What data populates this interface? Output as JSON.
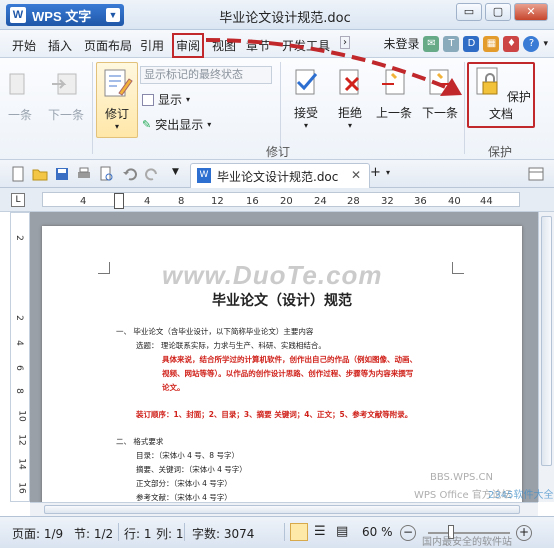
{
  "window": {
    "app_name": "WPS 文字",
    "doc_title": "毕业论文设计规范.doc",
    "controls": [
      "▭",
      "▢",
      "✕"
    ]
  },
  "menu": {
    "tabs": [
      "开始",
      "插入",
      "页面布局",
      "引用",
      "审阅",
      "视图",
      "章节",
      "开发工具"
    ],
    "login": "未登录"
  },
  "ribbon": {
    "prev_change": "一条",
    "next_change": "下一条",
    "revise": "修订",
    "markup_combo": "显示标记的最终状态",
    "show": "显示",
    "highlight": "突出显示",
    "accept": "接受",
    "reject": "拒绝",
    "prev": "上一条",
    "next": "下一条",
    "protect": "保护文档",
    "group_revise": "修订",
    "group_protect": "保护"
  },
  "doc_tab": {
    "title": "毕业论文设计规范.doc",
    "close": "✕",
    "add": "+"
  },
  "ruler": {
    "h_ticks": [
      "4",
      "4",
      "8",
      "12",
      "16",
      "20",
      "24",
      "28",
      "32",
      "36",
      "40",
      "44"
    ],
    "v_ticks": [
      "2",
      "2",
      "4",
      "6",
      "8",
      "10",
      "12",
      "14",
      "16"
    ]
  },
  "document": {
    "watermark": "www.DuoTe.com",
    "heading": "毕业论文（设计）规范",
    "lines": [
      {
        "text": "一、  毕业论文（含毕业设计，以下简称毕业论文）主要内容",
        "red": false
      },
      {
        "text": "选题：  理论联系实际，力求与生产、科研、实践相结合。",
        "red": false
      },
      {
        "text": "具体来说，结合所学过的计算机软件，创作出自己的作品（例如图像、动画、",
        "red": true
      },
      {
        "text": "视频、网站等等）。以作品的创作设计思路、创作过程、步骤等为内容来撰写",
        "red": true
      },
      {
        "text": "论文。",
        "red": true
      },
      {
        "text": "装订顺序：1、封面；2、目录；3、摘要  关键词；4、正文；5、参考文献等附录。",
        "red": true
      },
      {
        "text": "二、  格式要求",
        "red": false
      },
      {
        "text": "目录：（宋体小 4 号、8 号字）",
        "red": false
      },
      {
        "text": "摘要、关键词：（宋体小 4 号字）",
        "red": false
      },
      {
        "text": "正文部分：（宋体小 4 号字）",
        "red": false
      },
      {
        "text": "参考文献：（宋体小 4 号字）",
        "red": false
      }
    ]
  },
  "status": {
    "page": "页面: 1/9",
    "section": "节: 1/2",
    "row": "行: 1",
    "col": "列: 1",
    "words": "字数: 3074",
    "zoom": "60 %",
    "zoom_minus": "−",
    "zoom_plus": "+"
  },
  "overlay": {
    "site_wm_1": "BBS.WPS.CN",
    "site_wm_2": "WPS Office 官方论坛",
    "site_wm_3": "2345软件大全",
    "site_wm_4": "国内最安全的软件站"
  },
  "colors": {
    "highlight_red": "#c0282b",
    "accent_blue": "#1f57a8"
  }
}
